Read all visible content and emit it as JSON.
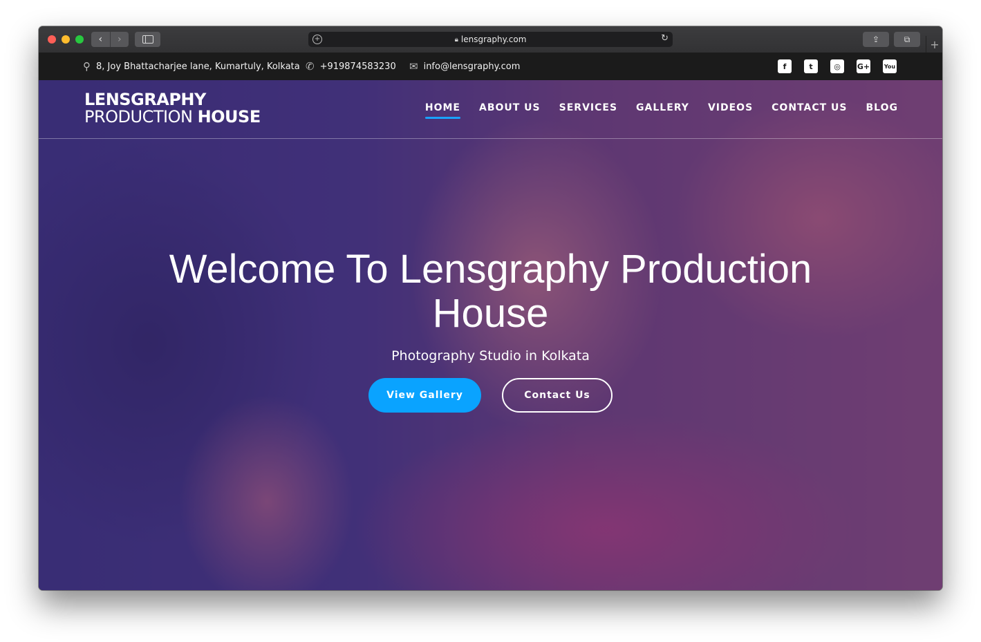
{
  "browser": {
    "url": "lensgraphy.com"
  },
  "topbar": {
    "address": "8, Joy Bhattacharjee lane, Kumartuly, Kolkata",
    "phone": "+919874583230",
    "email": "info@lensgraphy.com",
    "social_icons": [
      "facebook-icon",
      "twitter-icon",
      "instagram-icon",
      "google-plus-icon",
      "youtube-icon"
    ],
    "social_glyphs": [
      "f",
      "t",
      "◎",
      "G+",
      "You"
    ]
  },
  "logo": {
    "line1": "LENSGRAPHY",
    "line2_a": "PRODUCTION ",
    "line2_b": "HOUSE"
  },
  "nav": {
    "items": [
      "HOME",
      "ABOUT US",
      "SERVICES",
      "GALLERY",
      "VIDEOS",
      "CONTACT US",
      "BLOG"
    ],
    "active": "HOME"
  },
  "hero": {
    "title": "Welcome To Lensgraphy Production House",
    "subtitle": "Photography Studio in Kolkata",
    "primary_button": "View Gallery",
    "secondary_button": "Contact Us"
  },
  "colors": {
    "accent": "#0aa3ff",
    "overlay": "#4628a0",
    "topbar": "#1b1b1b"
  }
}
